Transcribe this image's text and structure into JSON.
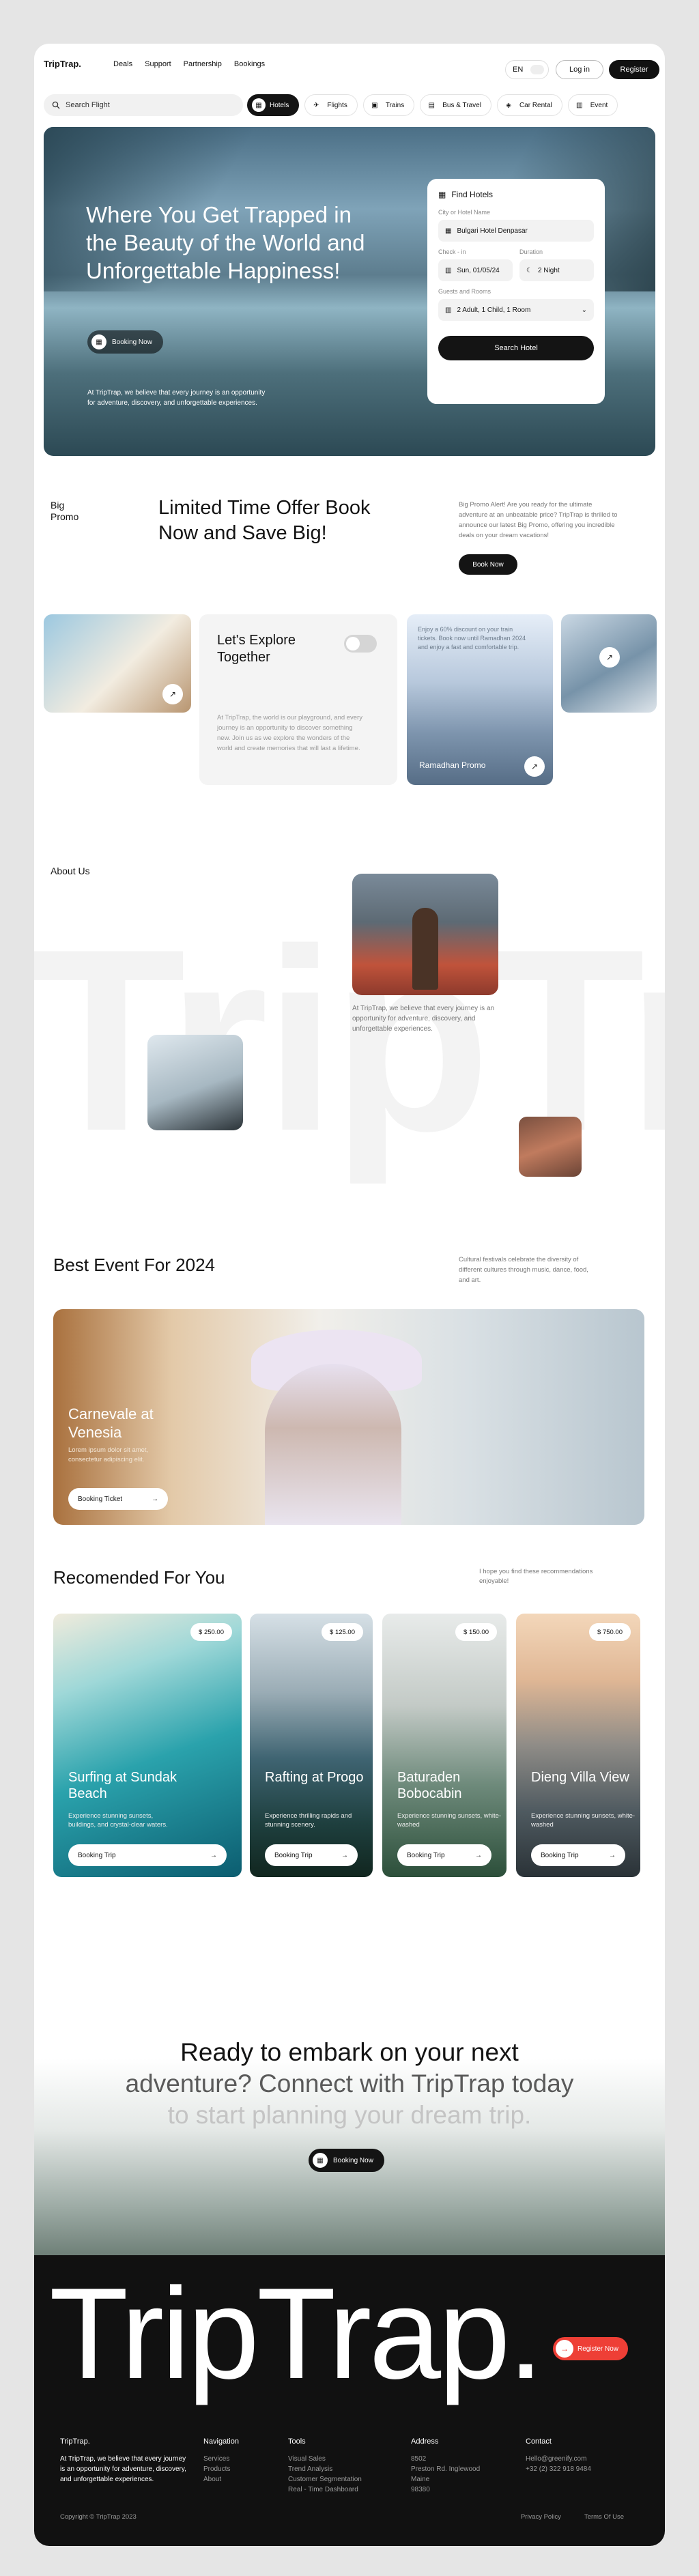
{
  "nav": {
    "logo": "TripTrap.",
    "links": [
      "Deals",
      "Support",
      "Partnership",
      "Bookings"
    ],
    "lang": "EN",
    "login": "Log in",
    "register": "Register"
  },
  "search": {
    "placeholder": "Search Flight"
  },
  "categories": [
    {
      "label": "Hotels",
      "icon": "hotel-icon"
    },
    {
      "label": "Flights",
      "icon": "plane-icon"
    },
    {
      "label": "Trains",
      "icon": "train-icon"
    },
    {
      "label": "Bus & Travel",
      "icon": "bus-icon"
    },
    {
      "label": "Car Rental",
      "icon": "car-icon"
    },
    {
      "label": "Event",
      "icon": "calendar-icon"
    }
  ],
  "hero": {
    "title": "Where You Get Trapped in the Beauty of the World and Unforgettable Happiness!",
    "button": "Booking Now",
    "desc": "At TripTrap, we believe that every journey is an opportunity for adventure, discovery, and unforgettable experiences."
  },
  "find_hotels": {
    "title": "Find Hotels",
    "city_label": "City or Hotel Name",
    "city_value": "Bulgari Hotel Denpasar",
    "checkin_label": "Check - in",
    "checkin_value": "Sun, 01/05/24",
    "duration_label": "Duration",
    "duration_value": "2 Night",
    "guests_label": "Guests and Rooms",
    "guests_value": "2 Adult, 1 Child, 1 Room",
    "button": "Search Hotel"
  },
  "promo": {
    "section_label": "Big Promo",
    "heading": "Limited Time Offer Book Now and Save Big!",
    "desc": "Big Promo Alert! Are you ready for the ultimate adventure at an unbeatable price? TripTrap is thrilled to announce our latest Big Promo, offering you incredible deals on your dream vacations!",
    "button": "Book Now",
    "card_title": "Let's Explore Together",
    "card_desc": "At TripTrap, the world is our playground, and every journey is an opportunity to discover something new. Join us as we explore the wonders of the world and create memories that will last a lifetime.",
    "ramadhan_desc": "Enjoy a 60% discount on your train tickets. Book now until Ramadhan 2024 and enjoy a fast and comfortable trip.",
    "ramadhan_title": "Ramadhan Promo"
  },
  "about": {
    "section_label": "About Us",
    "big_text": "TripTrap",
    "desc": "At TripTrap, we believe that every journey is an opportunity for adventure, discovery, and unforgettable experiences."
  },
  "best_event": {
    "heading": "Best Event For 2024",
    "desc": "Cultural festivals celebrate the diversity of different cultures through music, dance, food, and art.",
    "title": "Carnevale at Venesia",
    "card_desc": "Lorem ipsum dolor sit amet, consectetur adipiscing elit.",
    "button": "Booking Ticket"
  },
  "recommended": {
    "heading": "Recomended For You",
    "desc": "I hope you find these recommendations enjoyable!",
    "items": [
      {
        "title": "Surfing at Sundak Beach",
        "price": "$ 250.00",
        "desc": "Experience stunning sunsets, buildings, and crystal-clear waters.",
        "button": "Booking Trip"
      },
      {
        "title": "Rafting at Progo",
        "price": "$ 125.00",
        "desc": "Experience thrilling rapids and stunning scenery.",
        "button": "Booking Trip"
      },
      {
        "title": "Baturaden Bobocabin",
        "price": "$ 150.00",
        "desc": "Experience stunning sunsets, white-washed",
        "button": "Booking Trip"
      },
      {
        "title": "Dieng Villa View",
        "price": "$ 750.00",
        "desc": "Experience stunning sunsets, white-washed",
        "button": "Booking Trip"
      }
    ]
  },
  "cta": {
    "line1": "Ready to embark on your next",
    "line2": "adventure? Connect with TripTrap today",
    "line3": "to start planning your dream trip.",
    "button": "Booking Now"
  },
  "footer": {
    "big_logo": "TripTrap.",
    "register": "Register Now",
    "brand": "TripTrap.",
    "brand_desc": "At TripTrap, we believe that every journey is an opportunity for adventure, discovery, and unforgettable experiences.",
    "navigation": {
      "title": "Navigation",
      "items": [
        "Services",
        "Products",
        "About"
      ]
    },
    "tools": {
      "title": "Tools",
      "items": [
        "Visual Sales",
        "Trend Analysis",
        "Customer Segmentation",
        "Real - Time Dashboard"
      ]
    },
    "address": {
      "title": "Address",
      "items": [
        "8502",
        "Preston Rd. Inglewood",
        "Maine",
        "98380"
      ]
    },
    "contact": {
      "title": "Contact",
      "items": [
        "Hello@greenify.com",
        "+32 (2) 322 918 9484"
      ]
    },
    "copyright": "Copyright © TripTrap 2023",
    "privacy": "Privacy Policy",
    "terms": "Terms Of Use"
  }
}
